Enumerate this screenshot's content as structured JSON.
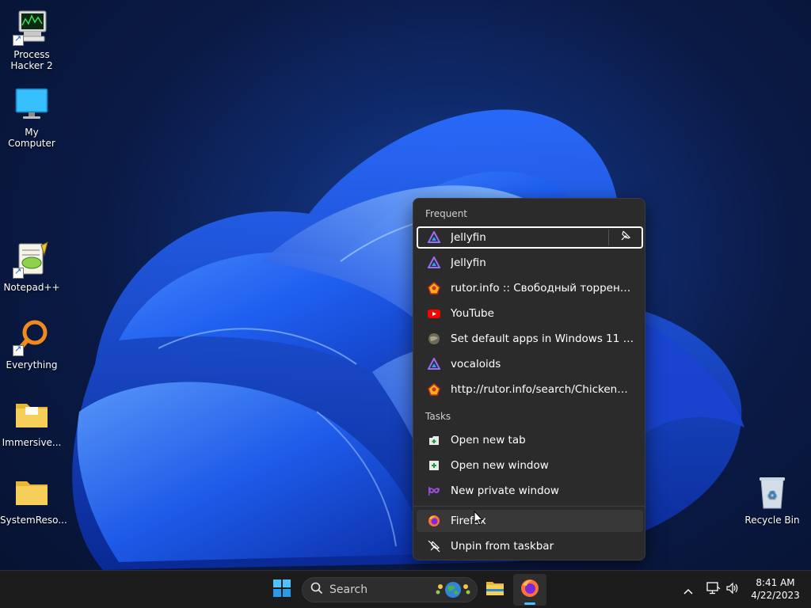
{
  "desktop": {
    "icons": [
      {
        "label_line1": "Process",
        "label_line2": "Hacker 2"
      },
      {
        "label": "My Computer"
      },
      {
        "label": "Notepad++"
      },
      {
        "label": "Everything"
      },
      {
        "label": "Immersive..."
      },
      {
        "label": "SystemReso..."
      },
      {
        "label": "Recycle Bin"
      }
    ]
  },
  "jumplist": {
    "frequent_heading": "Frequent",
    "tasks_heading": "Tasks",
    "frequent": [
      {
        "label": "Jellyfin",
        "icon": "jellyfin-icon"
      },
      {
        "label": "Jellyfin",
        "icon": "jellyfin-icon"
      },
      {
        "label": "rutor.info :: Свободный торрент тр...",
        "icon": "rutor-icon"
      },
      {
        "label": "YouTube",
        "icon": "youtube-icon"
      },
      {
        "label": "Set default apps in Windows 11 (rest...",
        "icon": "globe-icon"
      },
      {
        "label": "vocaloids",
        "icon": "jellyfin-icon"
      },
      {
        "label": "http://rutor.info/search/Chicken%20...",
        "icon": "rutor-icon"
      }
    ],
    "tasks": [
      {
        "label": "Open new tab",
        "icon": "new-tab-icon"
      },
      {
        "label": "Open new window",
        "icon": "new-window-icon"
      },
      {
        "label": "New private window",
        "icon": "private-window-icon"
      }
    ],
    "app": {
      "label": "Firefox",
      "icon": "firefox-icon"
    },
    "unpin": {
      "label": "Unpin from taskbar",
      "icon": "unpin-icon"
    }
  },
  "taskbar": {
    "search_label": "Search",
    "clock": {
      "time": "8:41 AM",
      "date": "4/22/2023"
    }
  },
  "colors": {
    "accent": "#0078d4",
    "jumplist_bg": "#2b2b2b",
    "taskbar_bg": "#1c1c1c"
  }
}
